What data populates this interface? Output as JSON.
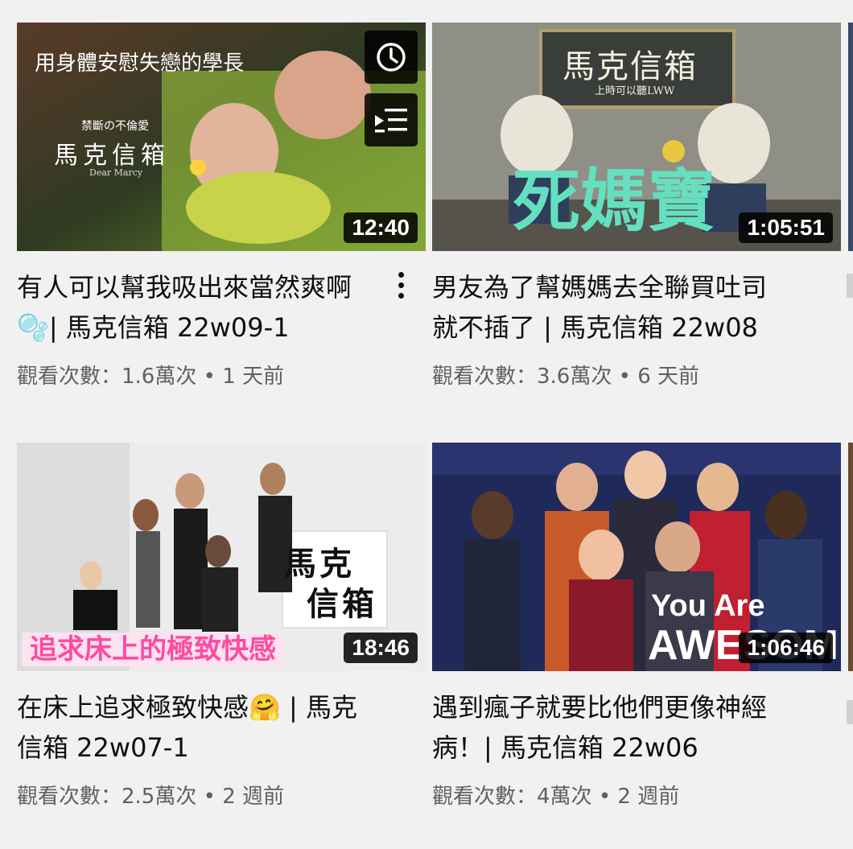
{
  "videos": [
    {
      "title": "有人可以幫我吸出來當然爽啊🫧| 馬克信箱 22w09-1",
      "views": "觀看次數：1.6萬次",
      "separator": "•",
      "age": "1 天前",
      "duration": "12:40",
      "thumb_caption": "用身體安慰失戀的學長",
      "thumb_sub": "禁斷の不倫愛",
      "thumb_logo": "馬克信箱",
      "thumb_logo_en": "Dear Marcy"
    },
    {
      "title": "男友為了幫媽媽去全聯買吐司就不插了 | 馬克信箱 22w08",
      "views": "觀看次數：3.6萬次",
      "separator": "•",
      "age": "6 天前",
      "duration": "1:05:51",
      "thumb_logo": "馬克信箱",
      "thumb_sub": "上時可以聽LWW",
      "thumb_big": "死媽寶"
    },
    {
      "title": "在床上追求極致快感🤗 | 馬克信箱 22w07-1",
      "views": "觀看次數：2.5萬次",
      "separator": "•",
      "age": "2 週前",
      "duration": "18:46",
      "thumb_logo_1": "馬克",
      "thumb_logo_2": "信箱",
      "thumb_banner": "追求床上的極致快感"
    },
    {
      "title": "遇到瘋子就要比他們更像神經病！| 馬克信箱 22w06",
      "views": "觀看次數：4萬次",
      "separator": "•",
      "age": "2 週前",
      "duration": "1:06:46",
      "thumb_line1": "You Are",
      "thumb_line2": "AWESOME"
    }
  ],
  "icons": {
    "watch_later": "clock-icon",
    "add_to_queue": "queue-icon",
    "menu": "more-vert-icon"
  }
}
